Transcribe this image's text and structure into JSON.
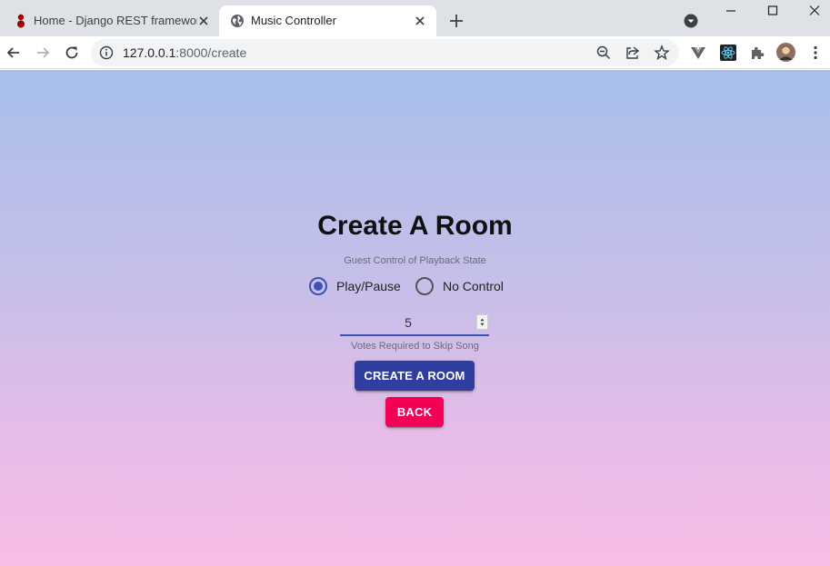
{
  "browser": {
    "tabs": [
      {
        "title": "Home - Django REST framework",
        "active": false,
        "favicon": "django-rest-icon"
      },
      {
        "title": "Music Controller",
        "active": true,
        "favicon": "globe-icon"
      }
    ],
    "address": {
      "host": "127.0.0.1",
      "path": ":8000/create"
    },
    "icons": [
      "back-arrow-icon",
      "forward-arrow-icon",
      "reload-icon",
      "info-icon",
      "zoom-out-icon",
      "share-icon",
      "star-icon",
      "vue-devtools-icon",
      "react-devtools-icon",
      "extensions-icon",
      "profile-avatar",
      "menu-kebab-icon"
    ]
  },
  "page": {
    "title": "Create A Room",
    "guest_control_label": "Guest Control of Playback State",
    "options": [
      {
        "label": "Play/Pause",
        "checked": true
      },
      {
        "label": "No Control",
        "checked": false
      }
    ],
    "votes_value": "5",
    "votes_helper": "Votes Required to Skip Song",
    "create_button": "CREATE A ROOM",
    "back_button": "BACK"
  },
  "colors": {
    "primary": "#303f9f",
    "secondary": "#f50057",
    "radio_accent": "#3f51b5",
    "gradient_top": "#a7bfeb",
    "gradient_bottom": "#f8bde6"
  }
}
